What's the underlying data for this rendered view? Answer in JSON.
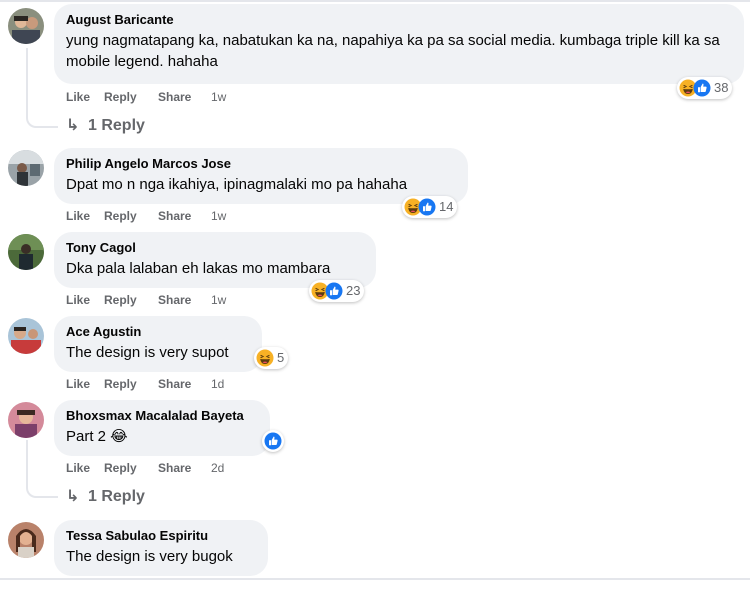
{
  "actions": {
    "like": "Like",
    "reply": "Reply",
    "share": "Share"
  },
  "comments": [
    {
      "name": "August Baricante",
      "text": "yung nagmatapang ka, nabatukan ka na, napahiya ka pa sa social media. kumbaga triple kill ka sa mobile legend. hahaha",
      "time": "1w",
      "reactions": {
        "icons": [
          "haha-icon",
          "like-icon"
        ],
        "count": "38"
      },
      "replies": "1 Reply"
    },
    {
      "name": "Philip Angelo Marcos Jose",
      "text": "Dpat mo n nga ikahiya, ipinagmalaki mo pa hahaha",
      "time": "1w",
      "reactions": {
        "icons": [
          "haha-icon",
          "like-icon"
        ],
        "count": "14"
      }
    },
    {
      "name": "Tony Cagol",
      "text": "Dka pala lalaban eh lakas mo mambara",
      "time": "1w",
      "reactions": {
        "icons": [
          "haha-icon",
          "like-icon"
        ],
        "count": "23"
      }
    },
    {
      "name": "Ace Agustin",
      "text": "The design is very supot",
      "time": "1d",
      "reactions": {
        "icons": [
          "haha-icon"
        ],
        "count": "5"
      }
    },
    {
      "name": "Bhoxsmax Macalalad Bayeta",
      "text": "Part 2 😂",
      "time": "2d",
      "reactions": {
        "icons": [
          "like-icon"
        ],
        "count": ""
      },
      "replies": "1 Reply"
    },
    {
      "name": "Tessa Sabulao Espiritu",
      "text": "The design is very bugok"
    }
  ],
  "colors": {
    "bubble": "#f0f2f5",
    "meta": "#65676b",
    "like_blue": "#1877f2",
    "haha_yellow": "#f7b125"
  }
}
